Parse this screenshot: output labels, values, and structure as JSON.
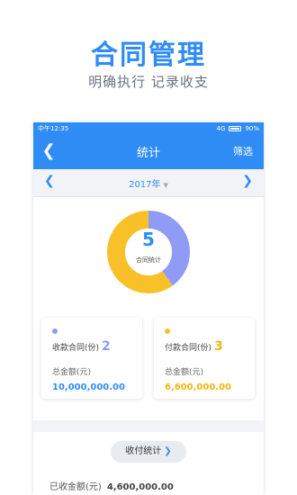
{
  "promo": {
    "title": "合同管理",
    "subtitle": "明确执行  记录收支"
  },
  "statusbar": {
    "time": "中午12:35",
    "signal": "4G",
    "battery": "90%"
  },
  "navbar": {
    "back_icon": "chevron-left-icon",
    "title": "统计",
    "filter_label": "筛选"
  },
  "yearbar": {
    "prev_icon": "chevron-left-icon",
    "year": "2017年",
    "next_icon": "chevron-right-icon"
  },
  "summary": {
    "total_count": "5",
    "total_label": "合同统计",
    "donut_segments": [
      {
        "name": "收款合同",
        "value": 2,
        "color": "#8f9bf5"
      },
      {
        "name": "付款合同",
        "value": 3,
        "color": "#f8c12a"
      }
    ]
  },
  "cards": {
    "receive": {
      "dot_color": "#8f9bf5",
      "label": "收款合同(份)",
      "count": "2",
      "amount_label": "总金额(元)",
      "amount": "10,000,000.00",
      "accent": "#2f8cf5"
    },
    "pay": {
      "dot_color": "#f8c12a",
      "label": "付款合同(份)",
      "count": "3",
      "amount_label": "总金额(元)",
      "amount": "6,600,000.00",
      "accent": "#f5b412"
    }
  },
  "payment_stats": {
    "button_label": "收付统计",
    "button_icon": "chevron-right-icon",
    "received_label": "已收金额(元)",
    "received_value": "4,600,000.00"
  }
}
